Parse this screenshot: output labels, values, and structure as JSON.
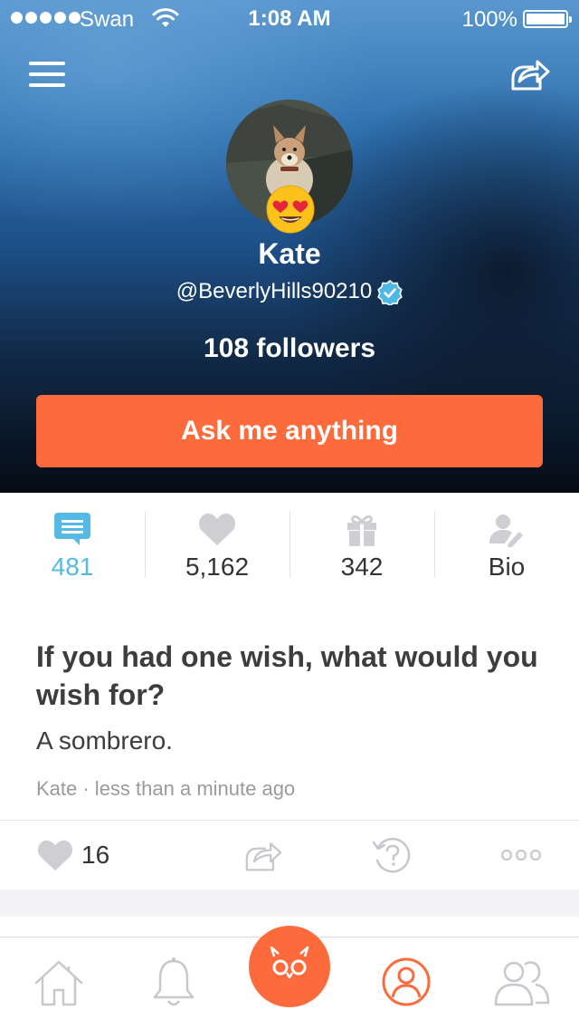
{
  "status_bar": {
    "carrier": "Swan",
    "time": "1:08 AM",
    "battery_percent": "100%",
    "battery_level": 1.0,
    "signal_dots": 5
  },
  "profile": {
    "name": "Kate",
    "handle": "@BeverlyHills90210",
    "verified": true,
    "followers": "108 followers",
    "ask_button": "Ask me anything"
  },
  "stats": [
    {
      "icon": "answers-icon",
      "value": "481",
      "active": true
    },
    {
      "icon": "heart-icon",
      "value": "5,162",
      "active": false
    },
    {
      "icon": "gift-icon",
      "value": "342",
      "active": false
    },
    {
      "icon": "bio-icon",
      "value": "Bio",
      "active": false
    }
  ],
  "post": {
    "question": "If you had one wish, what would you wish for?",
    "answer": "A sombrero.",
    "meta": "Kate · less than a minute ago",
    "likes": "16"
  },
  "tabbar": {
    "items": [
      "home-icon",
      "bell-icon",
      "ask-owl-icon",
      "profile-icon",
      "friends-icon"
    ],
    "active": "profile-icon"
  },
  "colors": {
    "accent": "#fd6a3c",
    "active_stat": "#55b9e3",
    "text_dark": "#3d3d3d",
    "text_muted": "#9a9a9f"
  }
}
